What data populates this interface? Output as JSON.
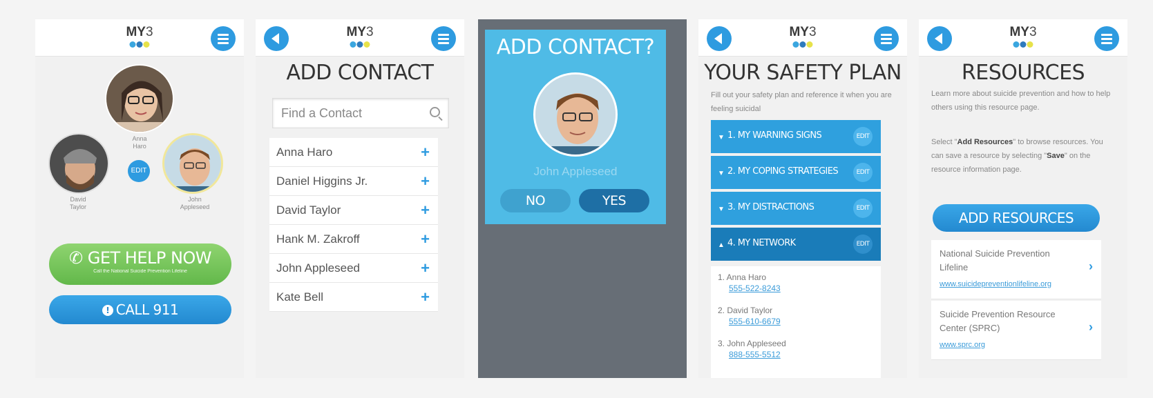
{
  "logo": {
    "my": "MY",
    "three": "3"
  },
  "home": {
    "contacts": [
      {
        "name_line1": "Anna",
        "name_line2": "Haro"
      },
      {
        "name_line1": "David",
        "name_line2": "Taylor"
      },
      {
        "name_line1": "John",
        "name_line2": "Appleseed"
      }
    ],
    "edit_label": "EDIT",
    "get_help_label": "GET HELP NOW",
    "get_help_sub": "Call the National Suicide Prevention Lifeline",
    "call_label": "CALL 911"
  },
  "add_contact": {
    "title": "ADD CONTACT",
    "search_placeholder": "Find a Contact",
    "contacts": [
      "Anna Haro",
      "Daniel Higgins Jr.",
      "David Taylor",
      "Hank M. Zakroff",
      "John Appleseed",
      "Kate Bell"
    ],
    "plus": "+"
  },
  "dialog": {
    "title": "ADD CONTACT?",
    "name": "John Appleseed",
    "no_label": "NO",
    "yes_label": "YES"
  },
  "safety_plan": {
    "title": "YOUR SAFETY PLAN",
    "subtitle": "Fill out your safety plan and reference it when you are feeling suicidal",
    "sections": [
      {
        "label": "1. MY WARNING SIGNS",
        "caret": "▼",
        "edit": "EDIT"
      },
      {
        "label": "2. MY COPING STRATEGIES",
        "caret": "▼",
        "edit": "EDIT"
      },
      {
        "label": "3. MY DISTRACTIONS",
        "caret": "▼",
        "edit": "EDIT"
      },
      {
        "label": "4. MY NETWORK",
        "caret": "▲",
        "edit": "EDIT"
      }
    ],
    "network": [
      {
        "name": "1. Anna Haro",
        "phone": "555-522-8243"
      },
      {
        "name": "2. David Taylor",
        "phone": "555-610-6679"
      },
      {
        "name": "3. John Appleseed",
        "phone": "888-555-5512"
      }
    ]
  },
  "resources": {
    "title": "RESOURCES",
    "para1": "Learn more about suicide prevention and how to help others using this resource page.",
    "para2_pre": "Select \"",
    "para2_bold1": "Add Resources",
    "para2_mid": "\" to browse resources. You can save a resource by selecting \"",
    "para2_bold2": "Save",
    "para2_post": "\" on the resource information page.",
    "add_label": "ADD RESOURCES",
    "items": [
      {
        "name": "National Suicide Prevention Lifeline",
        "url": "www.suicidepreventionlifeline.org"
      },
      {
        "name": "Suicide Prevention Resource Center (SPRC)",
        "url": "www.sprc.org"
      }
    ],
    "chevron": "›"
  }
}
